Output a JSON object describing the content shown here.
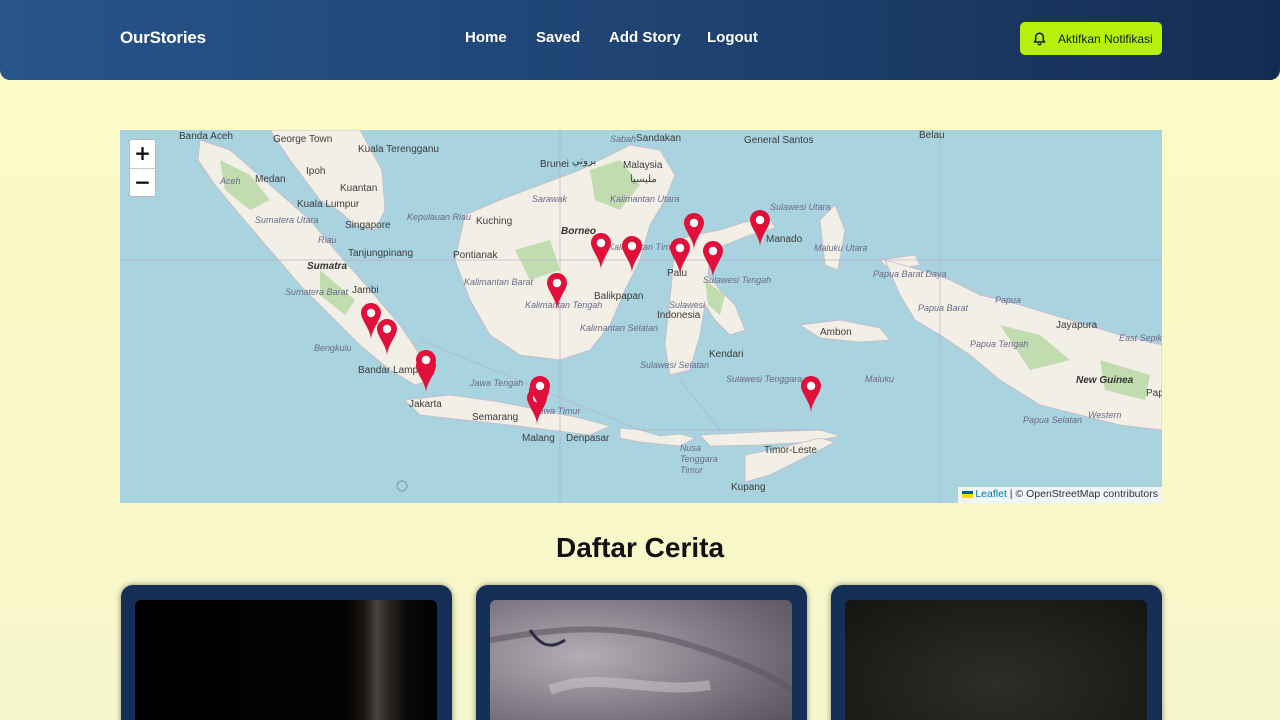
{
  "header": {
    "brand": "OurStories",
    "nav": [
      {
        "label": "Home"
      },
      {
        "label": "Saved"
      },
      {
        "label": "Add Story"
      },
      {
        "label": "Logout"
      }
    ],
    "notification_button": {
      "label": "Aktifkan Notifikasi",
      "icon": "bell-icon",
      "color": "#b6f00c"
    }
  },
  "map": {
    "zoom_in": "+",
    "zoom_out": "−",
    "attribution": {
      "leaflet": "Leaflet",
      "rest": "| © OpenStreetMap contributors"
    },
    "marker_color": "#e0103a",
    "labels": {
      "banda_aceh": "Banda Aceh",
      "george_town": "George Town",
      "kuala_terengganu": "Kuala Terengganu",
      "sandakan": "Sandakan",
      "sabah": "Sabah",
      "general_santos": "General Santos",
      "belau": "Belau",
      "brunei": "Brunei",
      "brunei_script": "بروني",
      "malaysia": "Malaysia",
      "malaysia_script": "مليسيا",
      "medan": "Medan",
      "ipoh": "Ipoh",
      "kuantan": "Kuantan",
      "aceh": "Aceh",
      "sarawak": "Sarawak",
      "kalimantan_utara": "Kalimantan Utara",
      "kuala_lumpur": "Kuala Lumpur",
      "sumatera_utara": "Sumatera Utara",
      "singapore": "Singapore",
      "kepulauan_riau": "Kepulauan Riau",
      "riau": "Riau",
      "kuching": "Kuching",
      "borneo": "Borneo",
      "kalimantan_timur": "Kalimantan Timur",
      "sulawesi_utara": "Sulawesi Utara",
      "manado": "Manado",
      "tanjungpinang": "Tanjungpinang",
      "sumatra": "Sumatra",
      "pontianak": "Pontianak",
      "palu": "Palu",
      "maluku_utara": "Maluku Utara",
      "papua_barat_daya": "Papua Barat Daya",
      "jambi": "Jambi",
      "kalimantan_barat": "Kalimantan Barat",
      "balikpapan": "Balikpapan",
      "sulawesi_tengah": "Sulawesi Tengah",
      "papua_barat": "Papua Barat",
      "papua": "Papua",
      "jayapura": "Jayapura",
      "sumatera_barat": "Sumatera Barat",
      "kalimantan_tengah": "Kalimantan Tengah",
      "sulawesi": "Sulawesi",
      "indonesia": "Indonesia",
      "ambon": "Ambon",
      "bengkulu": "Bengkulu",
      "kalimantan_selatan": "Kalimantan Selatan",
      "papua_tengah": "Papua Tengah",
      "east_sepik": "East Sepik",
      "kendari": "Kendari",
      "bandar_lampung": "Bandar Lampung",
      "sulawesi_selatan": "Sulawesi Selatan",
      "sulawesi_tenggara": "Sulawesi Tenggara",
      "maluku": "Maluku",
      "new_guinea": "New Guinea",
      "jawa_tengah": "Jawa Tengah",
      "jakarta": "Jakarta",
      "papua_barat2": "Papua",
      "jawa_timur": "Jawa Timur",
      "semarang": "Semarang",
      "papua_selatan": "Papua Selatan",
      "western": "Western",
      "malang": "Malang",
      "denpasar": "Denpasar",
      "nusa_tenggara_timur": "Nusa Tenggara Timur",
      "timor_leste": "Timor-Leste",
      "kupang": "Kupang"
    }
  },
  "stories": {
    "title": "Daftar Cerita",
    "cards": [
      {
        "thumb": "dark-photo"
      },
      {
        "thumb": "hand-photo"
      },
      {
        "thumb": "dim-photo"
      }
    ]
  }
}
